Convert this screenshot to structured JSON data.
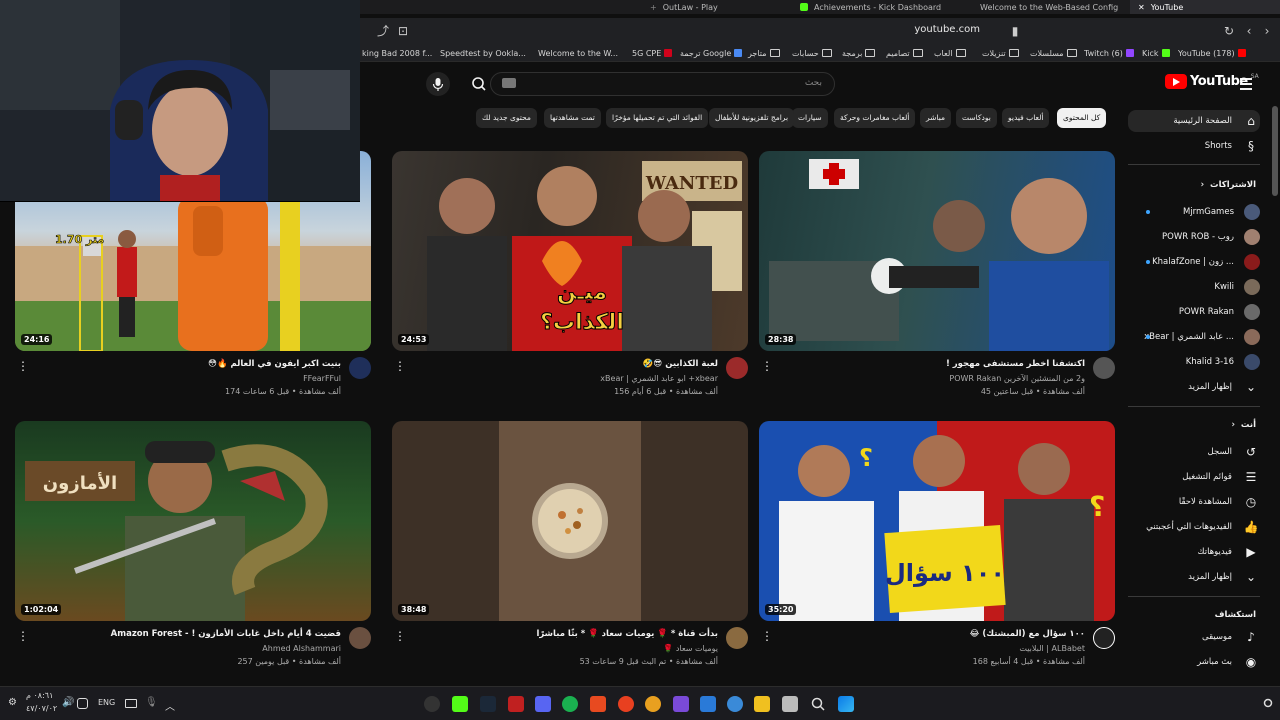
{
  "browser": {
    "tabs": [
      {
        "label": "OutLaw - Play"
      },
      {
        "label": "Achievements - Kick Dashboard"
      },
      {
        "label": "Welcome to the Web-Based Config"
      },
      {
        "label": "YouTube",
        "active": true
      }
    ],
    "url": "youtube.com",
    "bookmarks": [
      {
        "label": "YouTube (178)"
      },
      {
        "label": "Kick"
      },
      {
        "label": "Twitch (6)"
      },
      {
        "label": "مسلسلات"
      },
      {
        "label": "تنزيلات"
      },
      {
        "label": "العاب"
      },
      {
        "label": "تصاميم"
      },
      {
        "label": "برمجة"
      },
      {
        "label": "حسابات"
      },
      {
        "label": "متاجر"
      },
      {
        "label": "ترجمة Google"
      },
      {
        "label": "5G CPE"
      },
      {
        "label": "Welcome to the W..."
      },
      {
        "label": "Speedtest by Ookla..."
      },
      {
        "label": "king Bad 2008 f..."
      }
    ]
  },
  "header": {
    "logo_text": "YouTube",
    "country": "SA",
    "search_placeholder": "بحث"
  },
  "chips": [
    {
      "label": "كل المحتوى",
      "active": true
    },
    {
      "label": "ألعاب فيديو"
    },
    {
      "label": "بودكاست"
    },
    {
      "label": "مباشر"
    },
    {
      "label": "ألعاب مغامرات وحركة"
    },
    {
      "label": "سيارات"
    },
    {
      "label": "برامج تلفزيونية للأطفال"
    },
    {
      "label": "الفوائد التي تم تحميلها مؤخرًا"
    },
    {
      "label": "تمت مشاهدتها"
    },
    {
      "label": "محتوى جديد لك"
    }
  ],
  "sidebar": {
    "home": "الصفحة الرئيسية",
    "shorts": "Shorts",
    "subscriptions_heading": "الاشتراكات",
    "subscriptions": [
      {
        "name": "MjrmGames",
        "color": "#4a5a7a",
        "new": true
      },
      {
        "name": "POWR ROB - روب",
        "color": "#a08070",
        "new": false
      },
      {
        "name": "KhalafZone | زون ...",
        "color": "#8a1b1b",
        "new": true
      },
      {
        "name": "Kwili",
        "color": "#7a6a5a",
        "new": false
      },
      {
        "name": "POWR Rakan",
        "color": "#6a6a6a",
        "new": false
      },
      {
        "name": "xBear | عابد الشمري ...",
        "color": "#8a6a5a",
        "new": true
      },
      {
        "name": "Khalid 3-16",
        "color": "#3a4a6a",
        "new": false
      }
    ],
    "show_more_1": "إظهار المزيد",
    "you_heading": "أنت",
    "you_items": [
      {
        "label": "السجل",
        "icon": "history-icon"
      },
      {
        "label": "قوائم التشغيل",
        "icon": "playlist-icon"
      },
      {
        "label": "المشاهدة لاحقًا",
        "icon": "clock-icon"
      },
      {
        "label": "الفيديوهات التي أعجبتني",
        "icon": "thumb-up-icon"
      },
      {
        "label": "فيديوهاتك",
        "icon": "video-icon"
      }
    ],
    "show_more_2": "إظهار المزيد",
    "explore_heading": "استكشاف",
    "explore_items": [
      {
        "label": "موسيقى",
        "icon": "music-icon"
      },
      {
        "label": "بث مباشر",
        "icon": "live-icon"
      }
    ]
  },
  "videos": [
    {
      "title": "اكتشفنا اخطر مستشفى مهجور !",
      "channel": "POWR Rakan و2 من المنشئين الآخرين",
      "stats": "45 ألف مشاهدة • قبل ساعتين",
      "duration": "28:38",
      "thumb_colors": [
        "#1f3a3a",
        "#2f5050",
        "#1d4d8a"
      ],
      "avatar_color": "#555"
    },
    {
      "title": "لعبة الكذابين 😎🤣",
      "channel": "xBear | ابو عابد الشمري +xbear",
      "stats": "156 ألف مشاهدة • قبل 6 أيام",
      "duration": "24:53",
      "thumb_colors": [
        "#3a3530",
        "#8a1515",
        "#d1a040"
      ],
      "avatar_color": "#9b2a2a"
    },
    {
      "title": "بنيت اكبر ايفون في العالم 🔥😳",
      "channel": "FFearFFul",
      "stats": "174 ألف مشاهدة • قبل 6 ساعات",
      "duration": "24:16",
      "thumb_colors": [
        "#7aa0c8",
        "#e07020",
        "#6a9a40"
      ],
      "avatar_color": "#1f2f5a"
    },
    {
      "title": "١٠٠ سؤال مع (المبشتك) 😂",
      "channel": "البلابيت | ALBabet",
      "stats": "168 ألف مشاهدة • قبل 4 أسابيع",
      "duration": "35:20",
      "thumb_colors": [
        "#1a4fb0",
        "#c01a1a",
        "#f0d020"
      ],
      "avatar_color": "#222"
    },
    {
      "title": "بدأت قناة * 🌹 يوميات سعاد 🌹 * بثًا مباشرًا",
      "channel": "🌹 يوميات سعاد",
      "stats": "53 ألف مشاهدة • تم البث قبل 9 ساعات",
      "duration": "38:48",
      "thumb_colors": [
        "#3d3026",
        "#6a5340",
        "#3d3026"
      ],
      "avatar_color": "#8a6a40"
    },
    {
      "title": "قضيت 4 أيام داخل غابات الأمازون ! - Amazon Forest",
      "channel": "Ahmed Alshammari",
      "stats": "257 ألف مشاهدة • قبل يومين",
      "duration": "1:02:04",
      "thumb_colors": [
        "#1a3a20",
        "#3a6a30",
        "#6a4a20"
      ],
      "avatar_color": "#6a5040"
    }
  ],
  "taskbar": {
    "lang": "ENG",
    "time": "٠٨:٦١ م",
    "date": "٤٧/٠٧/٠٢"
  },
  "colors": {
    "background": "#0f0f0f",
    "chip": "#272727",
    "brand_red": "#ff0000"
  }
}
